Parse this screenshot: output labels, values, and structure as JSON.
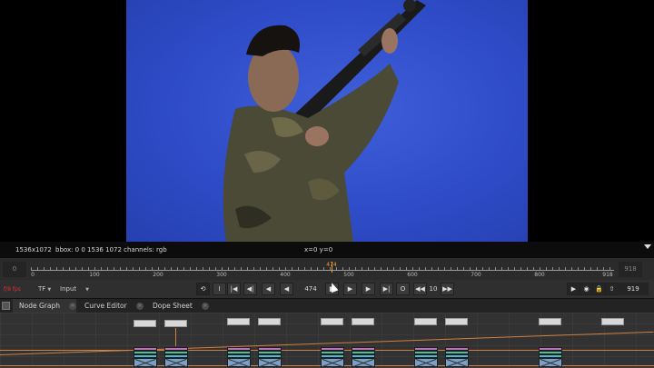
{
  "viewer": {
    "info_format": "1536x1072",
    "info_bbox": "bbox: 0 0 1536 1072 channels: rgb",
    "info_coords": "x=0 y=0"
  },
  "timeline": {
    "start": "0",
    "end": "918",
    "current_frame": "474",
    "ticks": [
      "0",
      "100",
      "200",
      "300",
      "400",
      "500",
      "600",
      "700",
      "800",
      "918"
    ]
  },
  "transport": {
    "fps_label": "f/8 fps",
    "tf_label": "TF",
    "input_label": "Input",
    "frame_value": "474",
    "increment_value": "10",
    "end_value": "919",
    "buttons": {
      "first": "|◀",
      "prev_key": "◀|",
      "prev_frame": "◀",
      "play_back": "◀",
      "stop": "■",
      "play_fwd": "▶",
      "next_frame": "▶",
      "next_key": "|▶",
      "last": "▶|",
      "skip_back": "◀◀",
      "skip_fwd": "▶▶"
    }
  },
  "tabs": [
    {
      "label": "Node Graph",
      "active": true
    },
    {
      "label": "Curve Editor",
      "active": false
    },
    {
      "label": "Dope Sheet",
      "active": false
    }
  ],
  "colors": {
    "accent": "#f0a030",
    "bluescreen": "#2f4cc8",
    "pipe": "#d08040"
  }
}
